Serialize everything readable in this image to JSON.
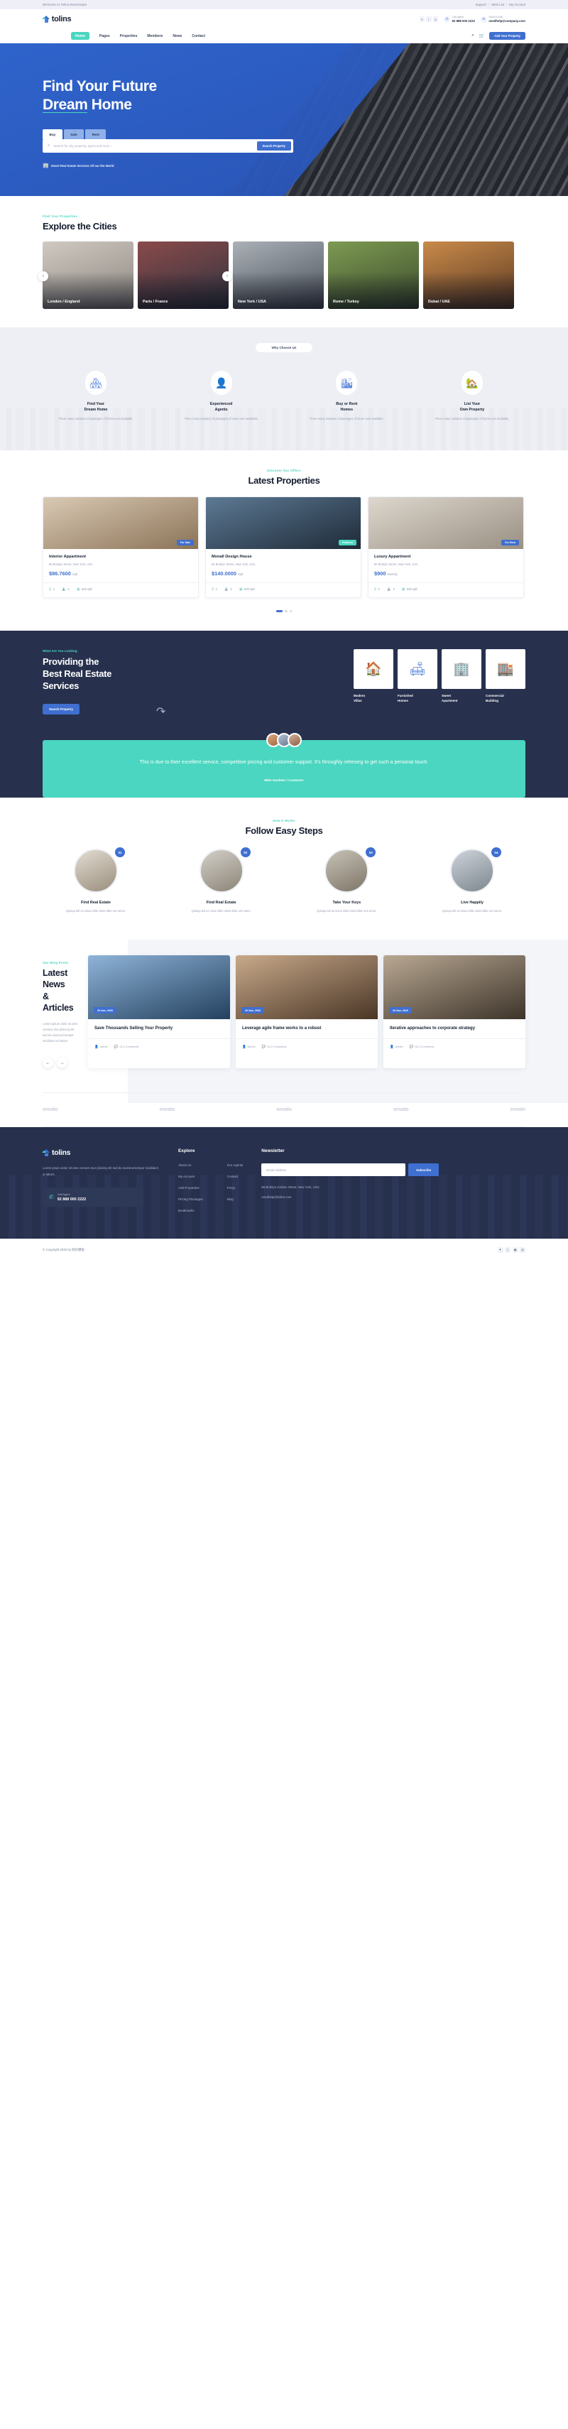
{
  "topbar": {
    "welcome": "Welcome to Tolins Real Estate",
    "support": "Support",
    "wishlist": "Wish List",
    "account": "My Account",
    "sep": "/"
  },
  "header": {
    "brand": "tolins",
    "socials": [
      "twitter-icon",
      "facebook-icon",
      "instagram-icon"
    ],
    "call": {
      "label": "Call Agent",
      "value": "92 888 000 2222"
    },
    "email": {
      "label": "Send E-mail",
      "value": "needhelp@company.com"
    }
  },
  "nav": {
    "items": [
      "Home",
      "Pages",
      "Properties",
      "Members",
      "News",
      "Contact"
    ],
    "active": "Home",
    "add_property": "Add Your Property"
  },
  "hero": {
    "title_line1": "Find Your Future",
    "title_line2_underline": "Dream",
    "title_line2_rest": " Home",
    "tabs": [
      "Buy",
      "Sale",
      "Rent"
    ],
    "active_tab": "Buy",
    "search_placeholder": "Search for city, property, agent and more...",
    "search_button": "Search Property",
    "note": "Smart Real Estate Services All our the World"
  },
  "cities": {
    "eyebrow": "Find Your Properties",
    "title": "Explore the Cities",
    "items": [
      {
        "label": "London / England",
        "c1": "#cfc9c2",
        "c2": "#8d8680"
      },
      {
        "label": "Paris / France",
        "c1": "#8a4a4a",
        "c2": "#2f3440"
      },
      {
        "label": "New York / USA",
        "c1": "#aab0b6",
        "c2": "#4a5058"
      },
      {
        "label": "Rome / Turkey",
        "c1": "#7d9a52",
        "c2": "#3c4c2c"
      },
      {
        "label": "Dubai / UAE",
        "c1": "#c98a4a",
        "c2": "#5c3a22"
      }
    ]
  },
  "why": {
    "badge": "Why Choose Us",
    "features": [
      {
        "title": "Find Your\nDream Home",
        "desc": "There many variation of passages of lorem sum available.",
        "icon": "building-home-icon"
      },
      {
        "title": "Experienced\nAgents",
        "desc": "There many variation of passages of lorem sum available.",
        "icon": "agent-icon"
      },
      {
        "title": "Buy or Rent\nHomes",
        "desc": "There many variation of passages of lorem sum available.",
        "icon": "hand-house-icon"
      },
      {
        "title": "List Your\nOwn Property",
        "desc": "There many variation of passages of lorem sum available.",
        "icon": "listing-icon"
      }
    ]
  },
  "latest": {
    "eyebrow": "Discover Our Offers",
    "title": "Latest Properties",
    "items": [
      {
        "title": "Interior Appartment",
        "address": "80 Broklyn Street, New York, USA",
        "price": "$86.7600",
        "unit": "Sqft",
        "tag": "For Sale",
        "tag_color": "#3f6fd0",
        "beds": "4",
        "baths": "2",
        "area": "500 sqft",
        "c1": "#d9c9b4",
        "c2": "#8b7357"
      },
      {
        "title": "Monall Design House",
        "address": "80 Broklyn Street, New York, USA",
        "price": "$140.0000",
        "unit": "Sqft",
        "tag": "Featured",
        "tag_color": "#4ad6c0",
        "beds": "4",
        "baths": "2",
        "area": "500 sqft",
        "c1": "#5d7a94",
        "c2": "#1e2a38"
      },
      {
        "title": "Luxury Appartment",
        "address": "80 Broklyn Street, New York, USA",
        "price": "$900",
        "unit": "Monthly",
        "tag": "For Rent",
        "tag_color": "#3f6fd0",
        "beds": "4",
        "baths": "2",
        "area": "500 sqft",
        "c1": "#ddd7cd",
        "c2": "#9a9084"
      }
    ]
  },
  "providing": {
    "eyebrow": "What Are You Looking",
    "title": "Providing the\nBest Real Estate\nServices",
    "button": "Search Property",
    "services": [
      {
        "name": "Modern\nVillas",
        "icon": "villa-icon"
      },
      {
        "name": "Furnished\nHomes",
        "icon": "furnished-home-icon"
      },
      {
        "name": "Sweet\nApartment",
        "icon": "apartment-icon"
      },
      {
        "name": "Commercial\nBuilding",
        "icon": "commercial-building-icon"
      }
    ]
  },
  "testimonial": {
    "quote": "This is due to their excellent service, competitive pricing and customer support. It's throughly refresing to get such a personal touch.",
    "author": "Mike Hardeen / Customer",
    "avatars": [
      "avatar-1",
      "avatar-2",
      "avatar-3"
    ]
  },
  "steps": {
    "eyebrow": "How It Works",
    "title": "Follow Easy Steps",
    "items": [
      {
        "num": "01",
        "title": "Find Real Estate",
        "desc": "Quisqu tell us nisus elitis vistra tibte orm anno.",
        "c1": "#e2dcd2",
        "c2": "#9a8e7c"
      },
      {
        "num": "02",
        "title": "Find Real Estate",
        "desc": "Quisqu tell us nisus elitis vistra tibte orm anno.",
        "c1": "#d4d0c8",
        "c2": "#8b8478"
      },
      {
        "num": "03",
        "title": "Take Your Keys",
        "desc": "Quisqu tell us nisus elitis vistra tibte orm anno.",
        "c1": "#c8c2b6",
        "c2": "#7d7568"
      },
      {
        "num": "04",
        "title": "Live Happily",
        "desc": "Quisqu tell us nisus elitis vistra tibte orm anno.",
        "c1": "#cdd4da",
        "c2": "#7e868e"
      }
    ]
  },
  "news": {
    "eyebrow": "Our Blog Posts",
    "title": "Latest News\n& Articles",
    "paragraph": "Lorem ipsum dolor sit ame consect etur pisicing elit sed do eiusmod tempor incididunt ut labore.",
    "items": [
      {
        "date": "20 Nov, 2020",
        "title": "Save Thousands Selling Your Property",
        "author": "Admin",
        "comments": "GL2 Comments",
        "c1": "#8fb4d8",
        "c2": "#23405e"
      },
      {
        "date": "20 Nov, 2020",
        "title": "Leverage agile frame works to a robust",
        "author": "Admin",
        "comments": "GL2 Comments",
        "c1": "#c8a98a",
        "c2": "#4a3626"
      },
      {
        "date": "20 Nov, 2020",
        "title": "Iterative approaches to corporate strategy",
        "author": "Admin",
        "comments": "GL2 Comments",
        "c1": "#b9a893",
        "c2": "#3d342a"
      }
    ]
  },
  "brands": [
    "envato",
    "envato",
    "envato",
    "envato",
    "envato"
  ],
  "footer": {
    "brand": "tolins",
    "desc": "Lorem ipsum dolor sit ame consect etur pisicing elit sed do eiusmod tempor incididunt ut labore.",
    "call_label": "Call Agent",
    "call_number": "92 888 000 2222",
    "explore_title": "Explore",
    "explore_col1": [
      "About Us",
      "My Account",
      "Add Properties",
      "Pricing Packages",
      "Bookmarks"
    ],
    "explore_col2": [
      "Our Agents",
      "Contact",
      "FAQs",
      "Blog"
    ],
    "newsletter_title": "Newsletter",
    "email_placeholder": "Email Address",
    "subscribe": "Subscribe",
    "address": "88 Broklyn Golden Street, New York, USA",
    "email": "needhelp@tolins.com"
  },
  "copyright": {
    "text": "© Copyright 2020 by 网页模板",
    "socials": [
      "twitter-icon",
      "facebook-icon",
      "dribbble-icon",
      "instagram-icon"
    ]
  }
}
